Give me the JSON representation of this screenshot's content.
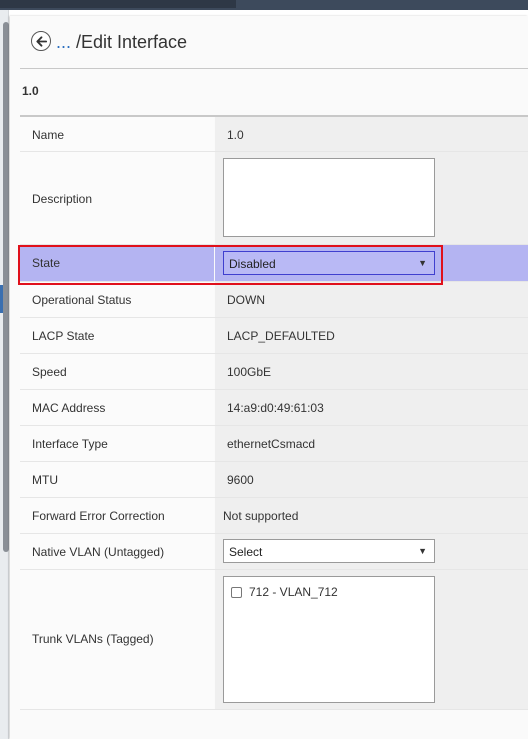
{
  "header": {
    "breadcrumb_prefix": "...",
    "title": "/Edit Interface"
  },
  "section_title": "1.0",
  "fields": {
    "name": {
      "label": "Name",
      "value": "1.0"
    },
    "description": {
      "label": "Description",
      "value": ""
    },
    "state": {
      "label": "State",
      "value": "Disabled"
    },
    "operational_status": {
      "label": "Operational Status",
      "value": "DOWN"
    },
    "lacp_state": {
      "label": "LACP State",
      "value": "LACP_DEFAULTED"
    },
    "speed": {
      "label": "Speed",
      "value": "100GbE"
    },
    "mac_address": {
      "label": "MAC Address",
      "value": "14:a9:d0:49:61:03"
    },
    "interface_type": {
      "label": "Interface Type",
      "value": "ethernetCsmacd"
    },
    "mtu": {
      "label": "MTU",
      "value": "9600"
    },
    "fec": {
      "label": "Forward Error Correction",
      "value": "Not supported"
    },
    "native_vlan": {
      "label": "Native VLAN (Untagged)",
      "value": "Select"
    },
    "trunk_vlans": {
      "label": "Trunk VLANs (Tagged)",
      "options": [
        {
          "label": "712 - VLAN_712",
          "checked": false
        }
      ]
    }
  },
  "icons": {
    "back": "arrow-left-circle-icon",
    "dropdown": "triangle-down-icon",
    "checkbox": "checkbox-icon"
  },
  "colors": {
    "highlight_border": "#e0101b",
    "state_row_bg": "#b4b4f2",
    "link": "#2a6ebf"
  }
}
